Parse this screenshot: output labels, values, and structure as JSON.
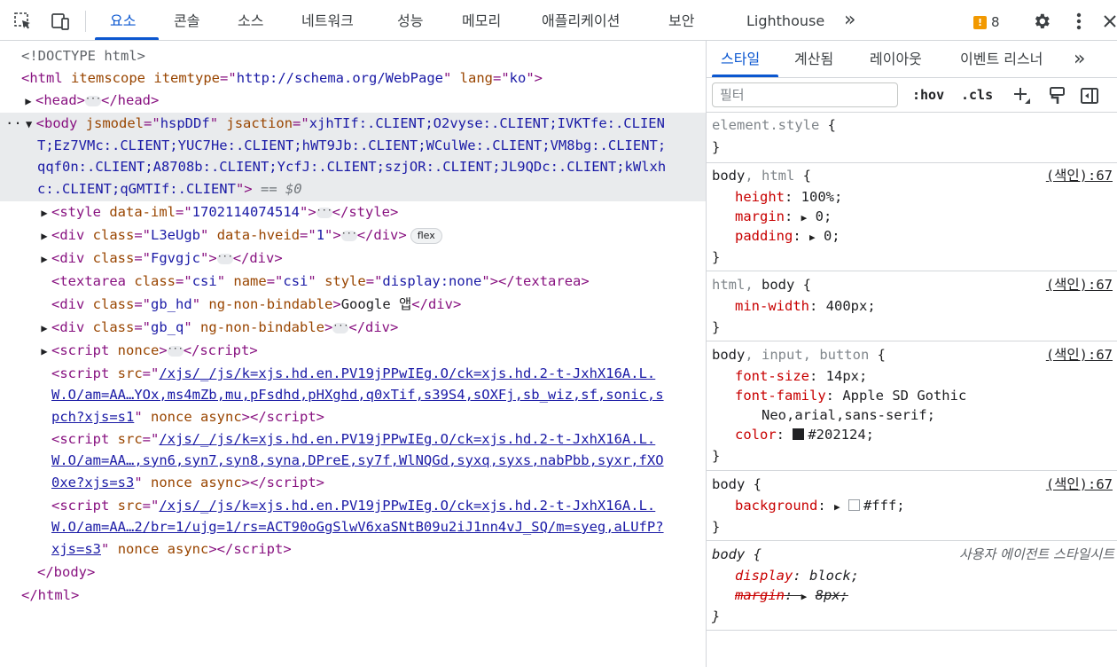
{
  "toolbar": {
    "tabs": [
      {
        "label": "요소",
        "active": true
      },
      {
        "label": "콘솔"
      },
      {
        "label": "소스"
      },
      {
        "label": "네트워크"
      },
      {
        "label": "성능"
      },
      {
        "label": "메모리"
      },
      {
        "label": "애플리케이션"
      },
      {
        "label": "보안"
      },
      {
        "label": "Lighthouse"
      }
    ],
    "more_tabs": "»",
    "issues_count": "8",
    "icons": [
      "inspect-element-icon",
      "device-toolbar-icon",
      "more-tabs-chevron-icon",
      "issues-flag-icon",
      "settings-gear-icon",
      "kebab-menu-icon",
      "close-icon"
    ],
    "accent_color": "#0b57d0"
  },
  "dom_tree": {
    "doctype": "<!DOCTYPE html>",
    "html_open": {
      "tag": "html",
      "attrs": [
        [
          "itemscope",
          null
        ],
        [
          "itemtype",
          "http://schema.org/WebPage"
        ],
        [
          "lang",
          "ko"
        ]
      ]
    },
    "head": "head",
    "body_attrs": {
      "jsmodel": "hspDDf",
      "jsaction_line1": "xjhTIf:.CLIENT;O2vyse:.CLIENT;IVKTfe:.CLIEN",
      "jsaction_line2": "T;Ez7VMc:.CLIENT;YUC7He:.CLIENT;hWT9Jb:.CLIENT;WCulWe:.CLIENT;VM8bg:.CLIENT;",
      "jsaction_line3": "qqf0n:.CLIENT;A8708b:.CLIENT;YcfJ:.CLIENT;szjOR:.CLIENT;JL9QDc:.CLIENT;kWlxh",
      "jsaction_line4": "c:.CLIENT;qGMTIf:.CLIENT",
      "selected_marker": "== $0"
    },
    "style_iml": "1702114074514",
    "div1_class": "L3eUgb",
    "div1_hveid": "1",
    "flex_badge": "flex",
    "div2_class": "Fgvgjc",
    "textarea": {
      "class": "csi",
      "name": "csi",
      "style": "display:none"
    },
    "gb_hd": {
      "class": "gb_hd",
      "attr": "ng-non-bindable",
      "text": "Google 앱"
    },
    "gb_q": {
      "class": "gb_q",
      "attr": "ng-non-bindable"
    },
    "script_nonce": "nonce",
    "script1_src": [
      "/xjs/_/js/k=xjs.hd.en.PV19jPPwIEg.O/ck=xjs.hd.2-t-JxhX16A.L.",
      "W.O/am=AA…YOx,ms4mZb,mu,pFsdhd,pHXghd,q0xTif,s39S4,sOXFj,sb_wiz,sf,sonic,s",
      "pch?xjs=s1"
    ],
    "script2_src": [
      "/xjs/_/js/k=xjs.hd.en.PV19jPPwIEg.O/ck=xjs.hd.2-t-JxhX16A.L.",
      "W.O/am=AA…,syn6,syn7,syn8,syna,DPreE,sy7f,WlNQGd,syxq,syxs,nabPbb,syxr,fXO",
      "0xe?xjs=s3"
    ],
    "script3_src": [
      "/xjs/_/js/k=xjs.hd.en.PV19jPPwIEg.O/ck=xjs.hd.2-t-JxhX16A.L.",
      "W.O/am=AA…2/br=1/ujg=1/rs=ACT90oGgSlwV6xaSNtB09u2iJ1nn4vJ_SQ/m=syeg,aLUfP?",
      "xjs=s3"
    ],
    "script_suffix": "nonce async",
    "body_close": "</body>",
    "html_close": "</html>"
  },
  "styles_pane": {
    "subtabs": [
      {
        "label": "스타일",
        "active": true
      },
      {
        "label": "계산됨"
      },
      {
        "label": "레이아웃"
      },
      {
        "label": "이벤트 리스너"
      }
    ],
    "more_subtabs": "»",
    "filter_placeholder": "필터",
    "hov_label": ":hov",
    "cls_label": ".cls",
    "rules": [
      {
        "selector_main": "element.style",
        "selector_dim": "",
        "brace": "{",
        "source": "",
        "props": []
      },
      {
        "selector_main": "body",
        "selector_dim": ", html",
        "source": "(색인):67",
        "props": [
          {
            "name": "height",
            "value": "100%;"
          },
          {
            "name": "margin",
            "value": "0;",
            "expandable": true
          },
          {
            "name": "padding",
            "value": "0;",
            "expandable": true
          }
        ]
      },
      {
        "selector_dim_first": "html, ",
        "selector_main": "body",
        "source": "(색인):67",
        "props": [
          {
            "name": "min-width",
            "value": "400px;"
          }
        ]
      },
      {
        "selector_main": "body",
        "selector_dim": ", input, button",
        "source": "(색인):67",
        "props": [
          {
            "name": "font-size",
            "value": "14px;"
          },
          {
            "name": "font-family",
            "value": "Apple SD Gothic",
            "value2": "Neo,arial,sans-serif;"
          },
          {
            "name": "color",
            "value": "#202124;",
            "swatch": "#202124"
          }
        ]
      },
      {
        "selector_main": "body",
        "source": "(색인):67",
        "props": [
          {
            "name": "background",
            "value": "#fff;",
            "swatch": "#ffffff",
            "expandable": true
          }
        ]
      },
      {
        "selector_main": "body",
        "source": "사용자 에이전트 스타일시트",
        "props": [
          {
            "name": "display",
            "value": "block;"
          },
          {
            "name": "margin",
            "value": "8px;",
            "struck": true,
            "expandable": true
          }
        ]
      }
    ]
  }
}
